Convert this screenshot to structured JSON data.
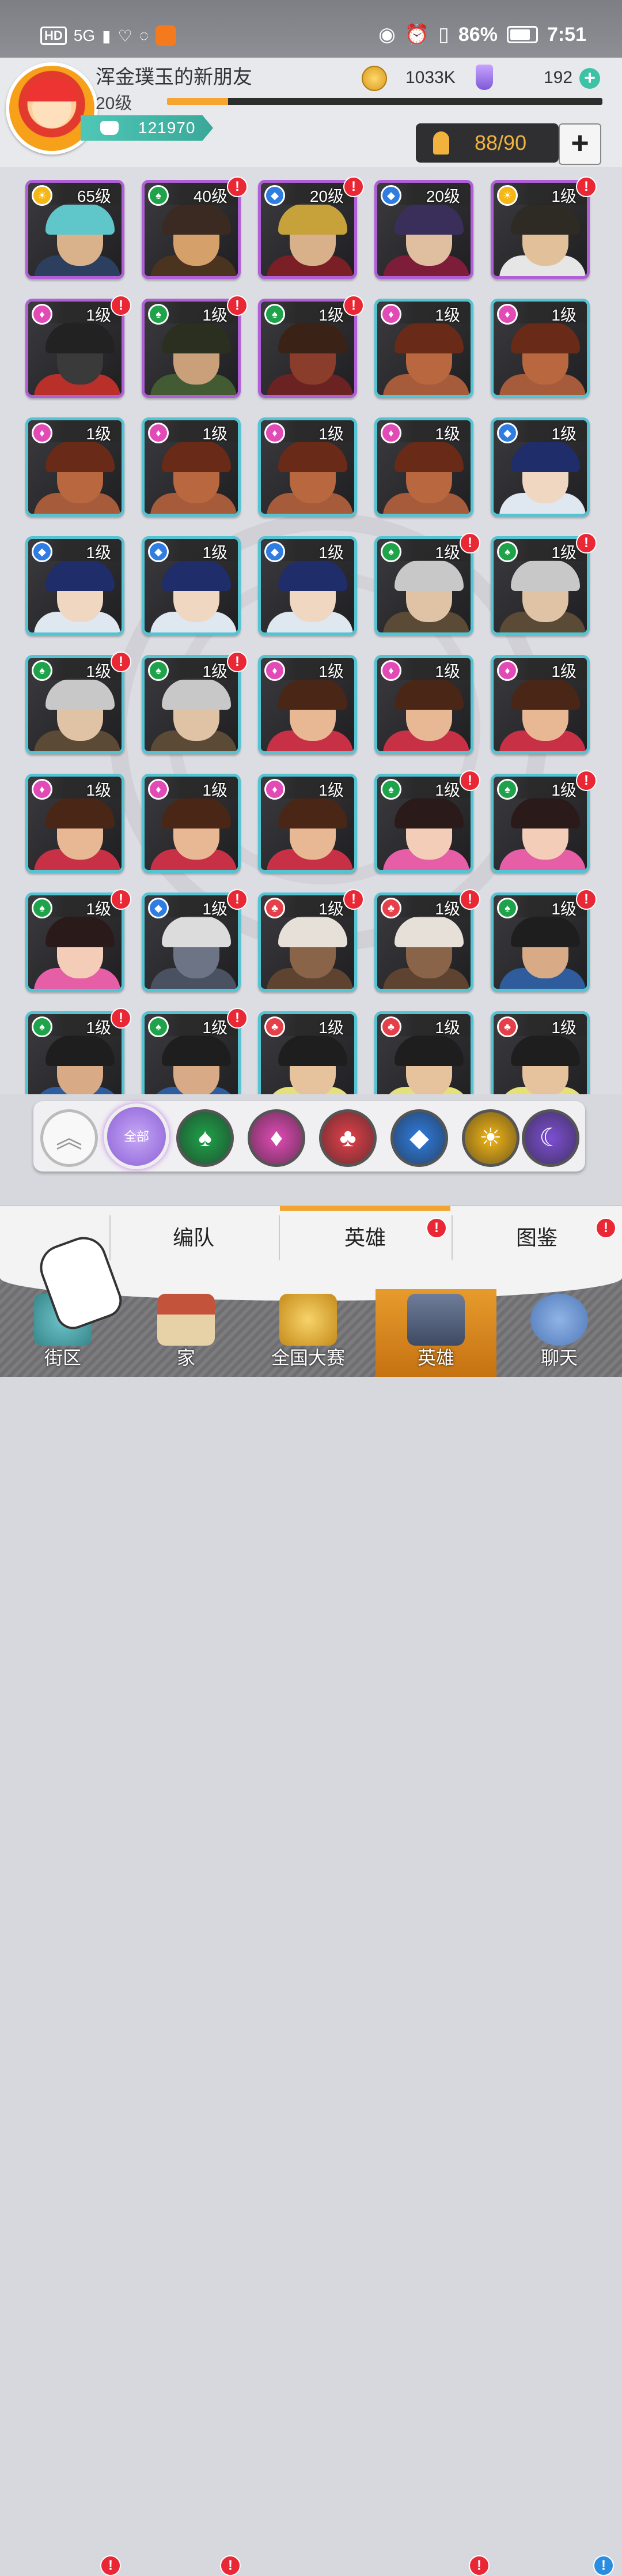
{
  "status": {
    "left": [
      "HD",
      "5G"
    ],
    "battery": "86%",
    "time": "7:51"
  },
  "player": {
    "name": "浑金璞玉的新朋友",
    "level": "20级",
    "power": "121970",
    "xp_fraction": 0.14
  },
  "currency": {
    "coins": "1033K",
    "gems": "192"
  },
  "capacity": "88/90",
  "colors": {
    "water": "#2f7de1",
    "forest": "#1ea34a",
    "heart": "#e24bb6",
    "sun": "#f4b716",
    "fire": "#e5404a",
    "moon": "#7c4fd4"
  },
  "heroes": [
    {
      "lvl": "65级",
      "elem": "sun",
      "frame": "purple",
      "alert": false,
      "skin": "#d9b28b",
      "hair": "#5fc7c9",
      "body": "#2c3f5e"
    },
    {
      "lvl": "40级",
      "elem": "forest",
      "frame": "purple",
      "alert": true,
      "skin": "#d6a06b",
      "hair": "#3a2a22",
      "body": "#4a3420"
    },
    {
      "lvl": "20级",
      "elem": "water",
      "frame": "purple",
      "alert": true,
      "skin": "#d8b08a",
      "hair": "#c7a23a",
      "body": "#7a1f25"
    },
    {
      "lvl": "20级",
      "elem": "water",
      "frame": "purple",
      "alert": false,
      "skin": "#e0bfa0",
      "hair": "#3a2f5a",
      "body": "#7d1d3a"
    },
    {
      "lvl": "1级",
      "elem": "sun",
      "frame": "purple",
      "alert": true,
      "skin": "#e2c09a",
      "hair": "#2e2a24",
      "body": "#e6e6e6"
    },
    {
      "lvl": "1级",
      "elem": "heart",
      "frame": "purple",
      "alert": true,
      "skin": "#3a3a3a",
      "hair": "#222",
      "body": "#b9302a"
    },
    {
      "lvl": "1级",
      "elem": "forest",
      "frame": "purple",
      "alert": true,
      "skin": "#c9a07a",
      "hair": "#2a2f1f",
      "body": "#425b32"
    },
    {
      "lvl": "1级",
      "elem": "forest",
      "frame": "purple",
      "alert": true,
      "skin": "#8a3d2a",
      "hair": "#3b2217",
      "body": "#6a2222"
    },
    {
      "lvl": "1级",
      "elem": "heart",
      "frame": "teal",
      "alert": false,
      "skin": "#b9673f",
      "hair": "#6a2a18",
      "body": "#a65b3a"
    },
    {
      "lvl": "1级",
      "elem": "heart",
      "frame": "teal",
      "alert": false,
      "skin": "#b9673f",
      "hair": "#6a2a18",
      "body": "#a65b3a"
    },
    {
      "lvl": "1级",
      "elem": "heart",
      "frame": "teal",
      "alert": false,
      "skin": "#b9673f",
      "hair": "#6a2a18",
      "body": "#a65b3a"
    },
    {
      "lvl": "1级",
      "elem": "heart",
      "frame": "teal",
      "alert": false,
      "skin": "#b9673f",
      "hair": "#6a2a18",
      "body": "#a65b3a"
    },
    {
      "lvl": "1级",
      "elem": "heart",
      "frame": "teal",
      "alert": false,
      "skin": "#b9673f",
      "hair": "#6a2a18",
      "body": "#a65b3a"
    },
    {
      "lvl": "1级",
      "elem": "heart",
      "frame": "teal",
      "alert": false,
      "skin": "#b9673f",
      "hair": "#6a2a18",
      "body": "#a65b3a"
    },
    {
      "lvl": "1级",
      "elem": "water",
      "frame": "teal",
      "alert": false,
      "skin": "#efd7c2",
      "hair": "#1f2d6b",
      "body": "#dfe7f0"
    },
    {
      "lvl": "1级",
      "elem": "water",
      "frame": "teal",
      "alert": false,
      "skin": "#efd7c2",
      "hair": "#1f2d6b",
      "body": "#dfe7f0"
    },
    {
      "lvl": "1级",
      "elem": "water",
      "frame": "teal",
      "alert": false,
      "skin": "#efd7c2",
      "hair": "#1f2d6b",
      "body": "#dfe7f0"
    },
    {
      "lvl": "1级",
      "elem": "water",
      "frame": "teal",
      "alert": false,
      "skin": "#efd7c2",
      "hair": "#1f2d6b",
      "body": "#dfe7f0"
    },
    {
      "lvl": "1级",
      "elem": "forest",
      "frame": "teal",
      "alert": true,
      "skin": "#e0c2a5",
      "hair": "#c8c8c8",
      "body": "#5b4a36"
    },
    {
      "lvl": "1级",
      "elem": "forest",
      "frame": "teal",
      "alert": true,
      "skin": "#e0c2a5",
      "hair": "#c8c8c8",
      "body": "#5b4a36"
    },
    {
      "lvl": "1级",
      "elem": "forest",
      "frame": "teal",
      "alert": true,
      "skin": "#e0c2a5",
      "hair": "#c8c8c8",
      "body": "#5b4a36"
    },
    {
      "lvl": "1级",
      "elem": "forest",
      "frame": "teal",
      "alert": true,
      "skin": "#e0c2a5",
      "hair": "#c8c8c8",
      "body": "#5b4a36"
    },
    {
      "lvl": "1级",
      "elem": "heart",
      "frame": "teal",
      "alert": false,
      "skin": "#e8b894",
      "hair": "#4a2616",
      "body": "#c83046"
    },
    {
      "lvl": "1级",
      "elem": "heart",
      "frame": "teal",
      "alert": false,
      "skin": "#e8b894",
      "hair": "#4a2616",
      "body": "#c83046"
    },
    {
      "lvl": "1级",
      "elem": "heart",
      "frame": "teal",
      "alert": false,
      "skin": "#e8b894",
      "hair": "#4a2616",
      "body": "#c83046"
    },
    {
      "lvl": "1级",
      "elem": "heart",
      "frame": "teal",
      "alert": false,
      "skin": "#e8b894",
      "hair": "#4a2616",
      "body": "#c83046"
    },
    {
      "lvl": "1级",
      "elem": "heart",
      "frame": "teal",
      "alert": false,
      "skin": "#e8b894",
      "hair": "#4a2616",
      "body": "#c83046"
    },
    {
      "lvl": "1级",
      "elem": "heart",
      "frame": "teal",
      "alert": false,
      "skin": "#e8b894",
      "hair": "#4a2616",
      "body": "#c83046"
    },
    {
      "lvl": "1级",
      "elem": "forest",
      "frame": "teal",
      "alert": true,
      "skin": "#f3cdb8",
      "hair": "#2a1a1a",
      "body": "#e65fa6"
    },
    {
      "lvl": "1级",
      "elem": "forest",
      "frame": "teal",
      "alert": true,
      "skin": "#f3cdb8",
      "hair": "#2a1a1a",
      "body": "#e65fa6"
    },
    {
      "lvl": "1级",
      "elem": "forest",
      "frame": "teal",
      "alert": true,
      "skin": "#f3cdb8",
      "hair": "#2a1a1a",
      "body": "#e65fa6"
    },
    {
      "lvl": "1级",
      "elem": "water",
      "frame": "teal",
      "alert": true,
      "skin": "#6c7486",
      "hair": "#dcdcdc",
      "body": "#4a5161"
    },
    {
      "lvl": "1级",
      "elem": "fire",
      "frame": "teal",
      "alert": true,
      "skin": "#8a6448",
      "hair": "#e6e0d8",
      "body": "#5e4430"
    },
    {
      "lvl": "1级",
      "elem": "fire",
      "frame": "teal",
      "alert": true,
      "skin": "#8a6448",
      "hair": "#e6e0d8",
      "body": "#5e4430"
    },
    {
      "lvl": "1级",
      "elem": "forest",
      "frame": "teal",
      "alert": true,
      "skin": "#d8ab86",
      "hair": "#1e1e1e",
      "body": "#2e5c9c"
    },
    {
      "lvl": "1级",
      "elem": "forest",
      "frame": "teal",
      "alert": true,
      "skin": "#d8ab86",
      "hair": "#1e1e1e",
      "body": "#2e5c9c"
    },
    {
      "lvl": "1级",
      "elem": "forest",
      "frame": "teal",
      "alert": true,
      "skin": "#d8ab86",
      "hair": "#1e1e1e",
      "body": "#2e5c9c"
    },
    {
      "lvl": "1级",
      "elem": "fire",
      "frame": "teal",
      "alert": false,
      "skin": "#e7c39d",
      "hair": "#1e1e1e",
      "body": "#e4e07a"
    },
    {
      "lvl": "1级",
      "elem": "fire",
      "frame": "teal",
      "alert": false,
      "skin": "#e7c39d",
      "hair": "#1e1e1e",
      "body": "#e4e07a"
    },
    {
      "lvl": "1级",
      "elem": "fire",
      "frame": "teal",
      "alert": false,
      "skin": "#e7c39d",
      "hair": "#1e1e1e",
      "body": "#e4e07a"
    }
  ],
  "filters": {
    "all_label": "全部"
  },
  "tabs": {
    "formation": "编队",
    "heroes": "英雄",
    "codex": "图鉴"
  },
  "nav": {
    "street": "街区",
    "home": "家",
    "tournament": "全国大赛",
    "heroes": "英雄",
    "chat": "聊天"
  }
}
